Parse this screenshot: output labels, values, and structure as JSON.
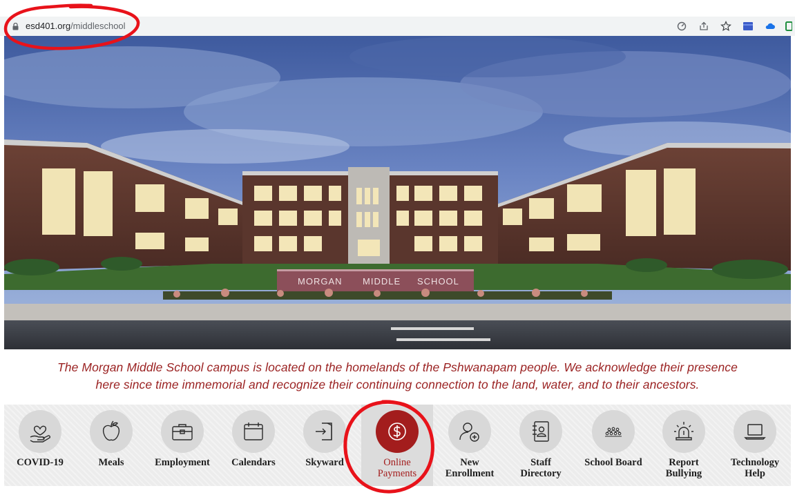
{
  "browser": {
    "url_domain": "esd401.org",
    "url_path": "/middleschool",
    "icons": [
      "tracking-icon",
      "share-icon",
      "bookmark-star-icon",
      "extension-blue-icon",
      "extension-cloud-icon",
      "extension-green-icon"
    ]
  },
  "hero": {
    "sign_words": [
      "MORGAN",
      "MIDDLE",
      "SCHOOL"
    ]
  },
  "acknowledgement": {
    "line1": "The Morgan Middle School campus is located on the homelands of the Pshwanapam people.  We acknowledge their presence",
    "line2": "here since time immemorial and recognize their continuing connection to the land, water, and to their ancestors."
  },
  "quick_links": [
    {
      "label": "COVID-19",
      "icon": "heart-hand-icon"
    },
    {
      "label": "Meals",
      "icon": "apple-icon"
    },
    {
      "label": "Employment",
      "icon": "briefcase-icon"
    },
    {
      "label": "Calendars",
      "icon": "calendar-icon"
    },
    {
      "label": "Skyward",
      "icon": "sign-in-door-icon"
    },
    {
      "label": "Online\nPayments",
      "icon": "dollar-circle-icon",
      "active": true
    },
    {
      "label": "New\nEnrollment",
      "icon": "add-user-icon"
    },
    {
      "label": "Staff\nDirectory",
      "icon": "contact-book-icon"
    },
    {
      "label": "School Board",
      "icon": "group-icon"
    },
    {
      "label": "Report\nBullying",
      "icon": "alarm-siren-icon"
    },
    {
      "label": "Technology\nHelp",
      "icon": "laptop-icon"
    }
  ],
  "colors": {
    "accent": "#a31d1d",
    "acknowledgement_text": "#9b2323",
    "annotation": "#e8121a"
  }
}
